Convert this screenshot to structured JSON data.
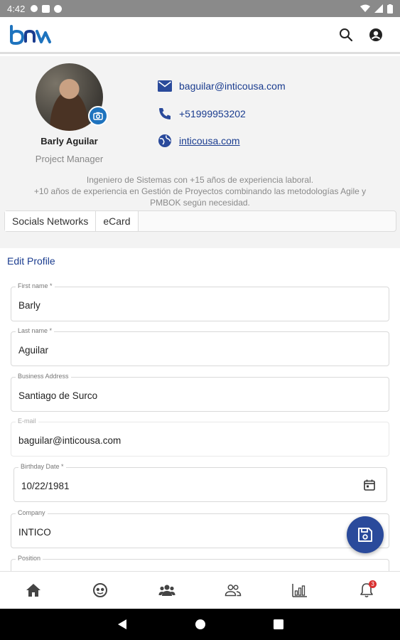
{
  "status_bar": {
    "time": "4:42"
  },
  "app": {
    "logo_text_a": "b",
    "logo_text_b": "w"
  },
  "profile": {
    "name": "Barly Aguilar",
    "role": "Project Manager",
    "email": "baguilar@inticousa.com",
    "phone": "+51999953202",
    "website": "inticousa.com",
    "bio_line1": "Ingeniero de Sistemas con +15 años de experiencia laboral.",
    "bio_line2": "+10 años de experiencia en Gestión de Proyectos combinando las metodologías Agile y",
    "bio_line3": "PMBOK según necesidad."
  },
  "tabs": [
    {
      "label": "Socials Networks"
    },
    {
      "label": "eCard"
    }
  ],
  "form": {
    "title": "Edit Profile",
    "fields": [
      {
        "label": "First name *",
        "value": "Barly"
      },
      {
        "label": "Last name *",
        "value": "Aguilar"
      },
      {
        "label": "Business Address",
        "value": "Santiago de Surco"
      },
      {
        "label": "E-mail",
        "value": "baguilar@inticousa.com"
      },
      {
        "label": "Birthday Date *",
        "value": "10/22/1981"
      },
      {
        "label": "Company",
        "value": "INTICO"
      },
      {
        "label": "Position",
        "value": ""
      }
    ]
  },
  "bottom_nav": {
    "items": [
      "home-icon",
      "face-icon",
      "group-icon",
      "people-outline-icon",
      "bar-chart-icon",
      "bell-icon"
    ],
    "notification_count": "3"
  },
  "colors": {
    "accent": "#1e73be",
    "primary_dark": "#1a3c8f",
    "fab": "#2a4a9b",
    "badge": "#d93030"
  }
}
